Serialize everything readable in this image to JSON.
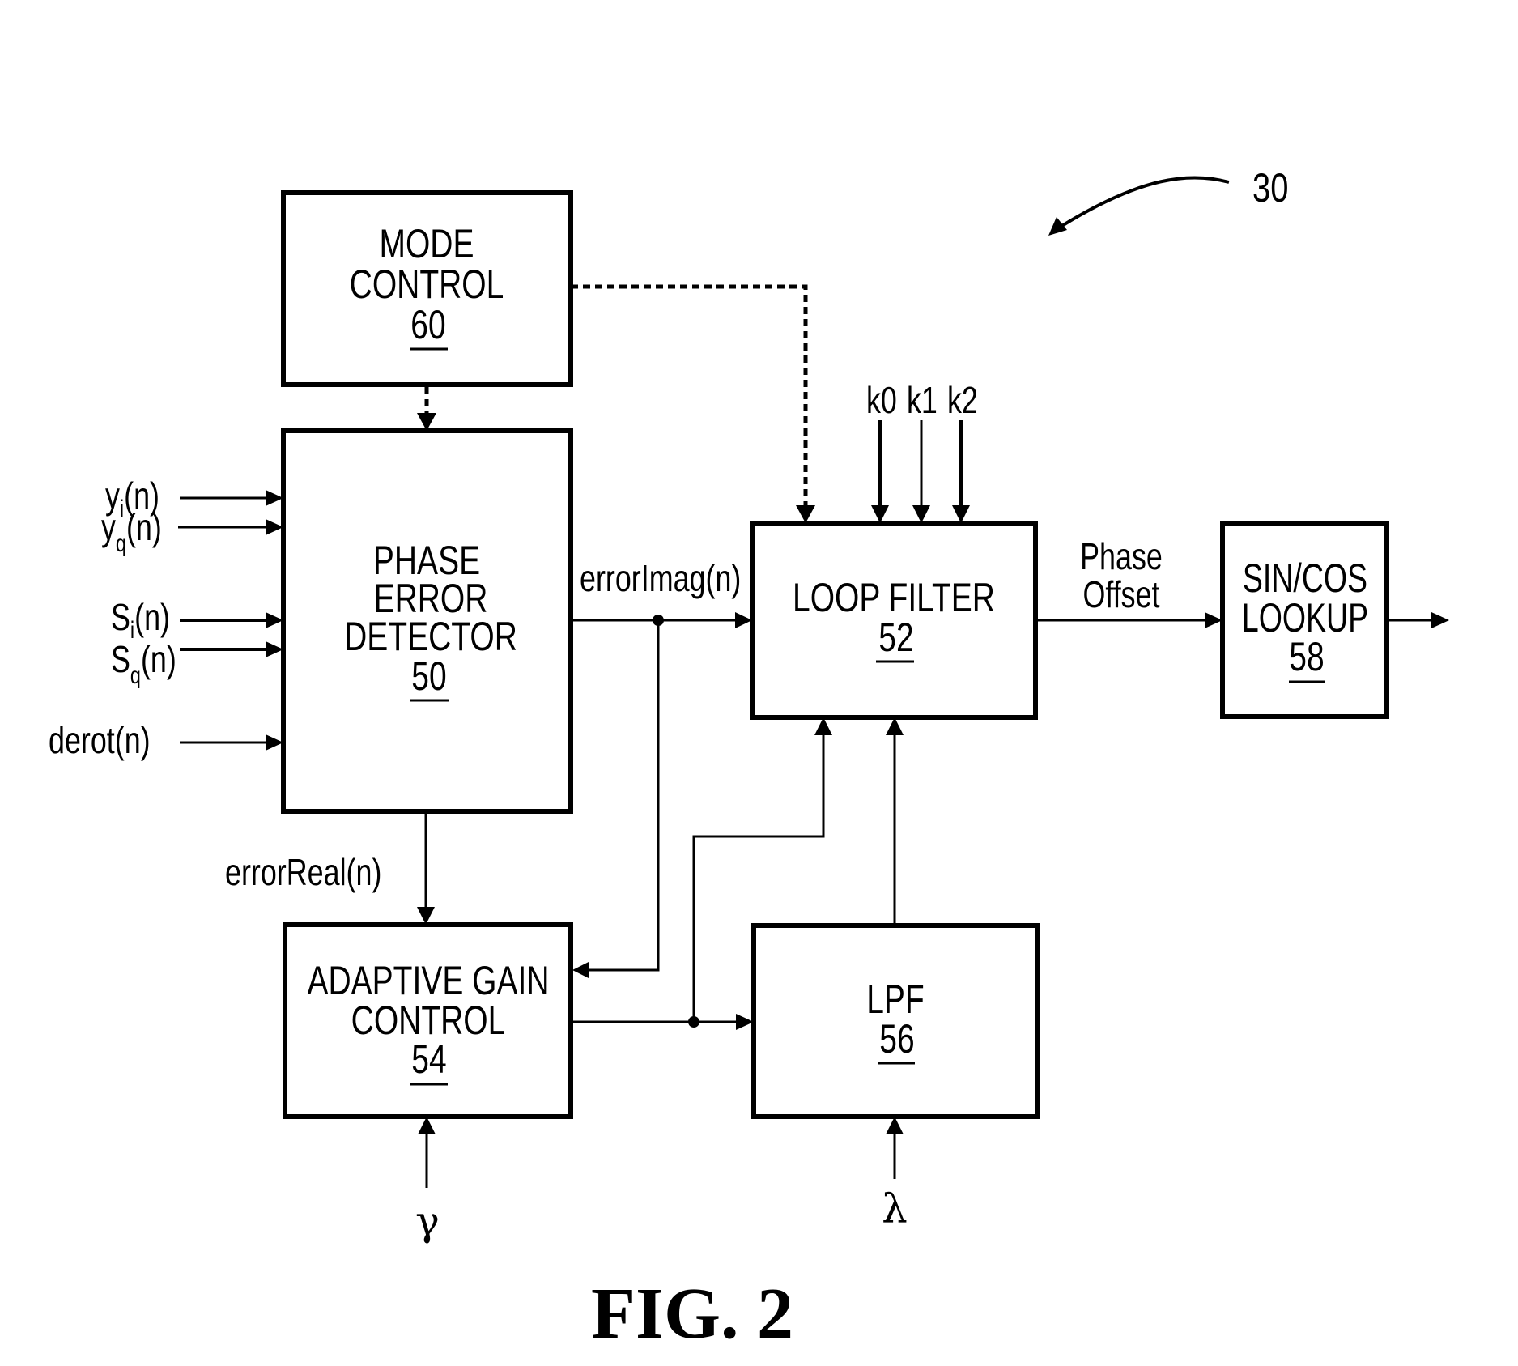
{
  "figure": {
    "caption": "FIG. 2",
    "reference_numeral": "30"
  },
  "blocks": {
    "mode_control": {
      "lines": [
        "MODE",
        "CONTROL"
      ],
      "number": "60"
    },
    "phase_error_detector": {
      "lines": [
        "PHASE",
        "ERROR",
        "DETECTOR"
      ],
      "number": "50"
    },
    "loop_filter": {
      "lines": [
        "LOOP FILTER"
      ],
      "number": "52"
    },
    "sin_cos_lookup": {
      "lines": [
        "SIN/COS",
        "LOOKUP"
      ],
      "number": "58"
    },
    "adaptive_gain_control": {
      "lines": [
        "ADAPTIVE GAIN",
        "CONTROL"
      ],
      "number": "54"
    },
    "lpf": {
      "lines": [
        "LPF"
      ],
      "number": "56"
    }
  },
  "inputs": {
    "yi": {
      "base": "y",
      "sub": "i",
      "suffix": "(n)"
    },
    "yq": {
      "base": "y",
      "sub": "q",
      "suffix": "(n)"
    },
    "si": {
      "base": "S",
      "sub": "i",
      "suffix": "(n)"
    },
    "sq": {
      "base": "S",
      "sub": "q",
      "suffix": "(n)"
    },
    "derot": {
      "text": "derot(n)"
    }
  },
  "signals": {
    "error_imag": "errorImag(n)",
    "error_real": "errorReal(n)",
    "phase_offset": [
      "Phase",
      "Offset"
    ],
    "k0": "k0",
    "k1": "k1",
    "k2": "k2",
    "gamma": "γ",
    "lambda": "λ"
  }
}
